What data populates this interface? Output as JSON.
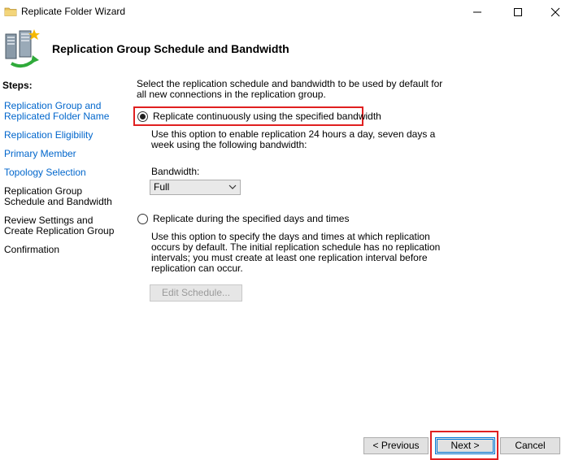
{
  "window": {
    "title": "Replicate Folder Wizard",
    "icon": "folder-icon"
  },
  "header": {
    "title": "Replication Group Schedule and Bandwidth",
    "icon": "replication-servers-icon"
  },
  "steps": {
    "heading": "Steps:",
    "items": [
      {
        "label": "Replication Group and Replicated Folder Name",
        "state": "link"
      },
      {
        "label": "Replication Eligibility",
        "state": "link"
      },
      {
        "label": "Primary Member",
        "state": "link"
      },
      {
        "label": "Topology Selection",
        "state": "link"
      },
      {
        "label": "Replication Group Schedule and Bandwidth",
        "state": "current"
      },
      {
        "label": "Review Settings and Create Replication Group",
        "state": "plain"
      },
      {
        "label": "Confirmation",
        "state": "plain"
      }
    ]
  },
  "main": {
    "intro": "Select the replication schedule and bandwidth to be used by default for all new connections in the replication group.",
    "option_continuous": {
      "label": "Replicate continuously using the specified bandwidth",
      "selected": true,
      "description": "Use this option to enable replication 24 hours a day, seven days a week using the following bandwidth:"
    },
    "bandwidth": {
      "label": "Bandwidth:",
      "value": "Full"
    },
    "option_scheduled": {
      "label": "Replicate during the specified days and times",
      "selected": false,
      "description": "Use this option to specify the days and times at which replication occurs by default. The initial replication schedule has no replication intervals; you must create at least one replication interval before replication can occur."
    },
    "edit_schedule_label": "Edit Schedule..."
  },
  "footer": {
    "previous_label": "< Previous",
    "next_label": "Next >",
    "cancel_label": "Cancel"
  },
  "colors": {
    "link": "#0066cc",
    "highlight": "#e02020",
    "default_button": "#0078d7"
  }
}
